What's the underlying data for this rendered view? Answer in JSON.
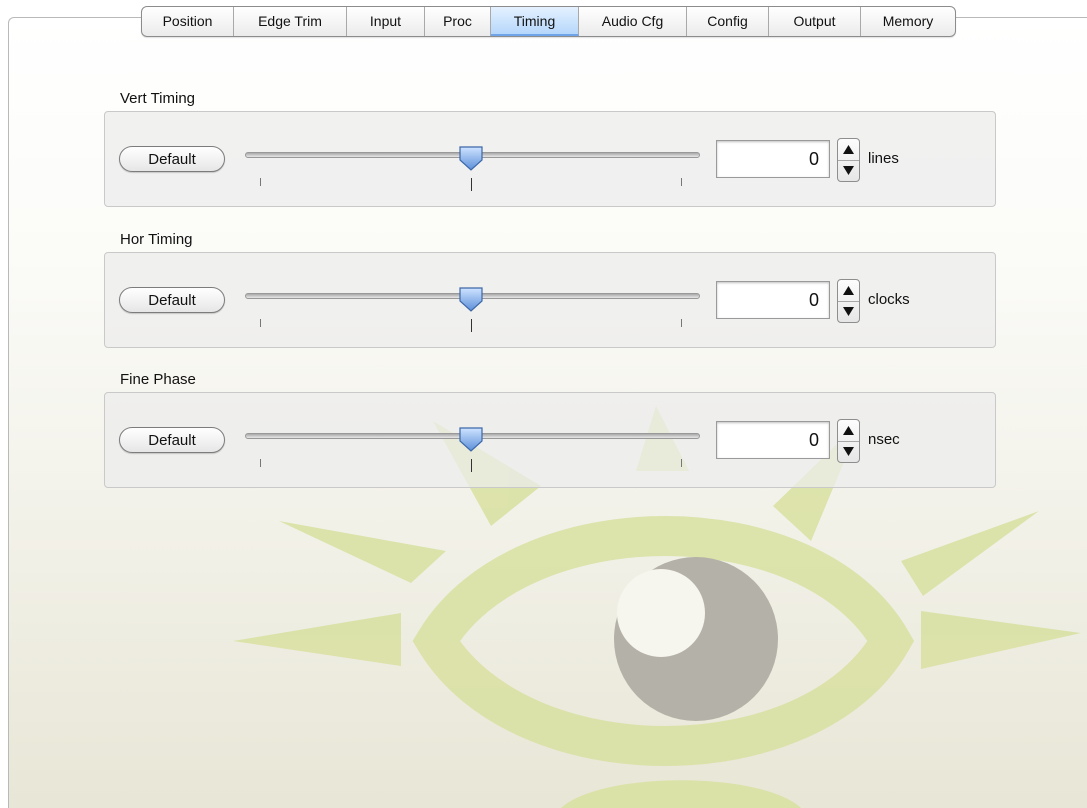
{
  "tabs": [
    "Position",
    "Edge Trim",
    "Input",
    "Proc",
    "Timing",
    "Audio Cfg",
    "Config",
    "Output",
    "Memory"
  ],
  "active_tab": "Timing",
  "sections": {
    "vert": {
      "title": "Vert Timing",
      "button": "Default",
      "value": "0",
      "unit": "lines",
      "slider_position": 0.5
    },
    "hor": {
      "title": "Hor Timing",
      "button": "Default",
      "value": "0",
      "unit": "clocks",
      "slider_position": 0.5
    },
    "fine": {
      "title": "Fine Phase",
      "button": "Default",
      "value": "0",
      "unit": "nsec",
      "slider_position": 0.5
    }
  },
  "icons": {
    "slider_thumb": "slider-thumb-icon",
    "stepper_up": "triangle-up-icon",
    "stepper_down": "triangle-down-icon",
    "watermark": "eye-logo-icon"
  },
  "colors": {
    "accent": "#b6d7fb",
    "watermark_green": "#d6df9e",
    "watermark_gray": "#b4b2a9"
  }
}
